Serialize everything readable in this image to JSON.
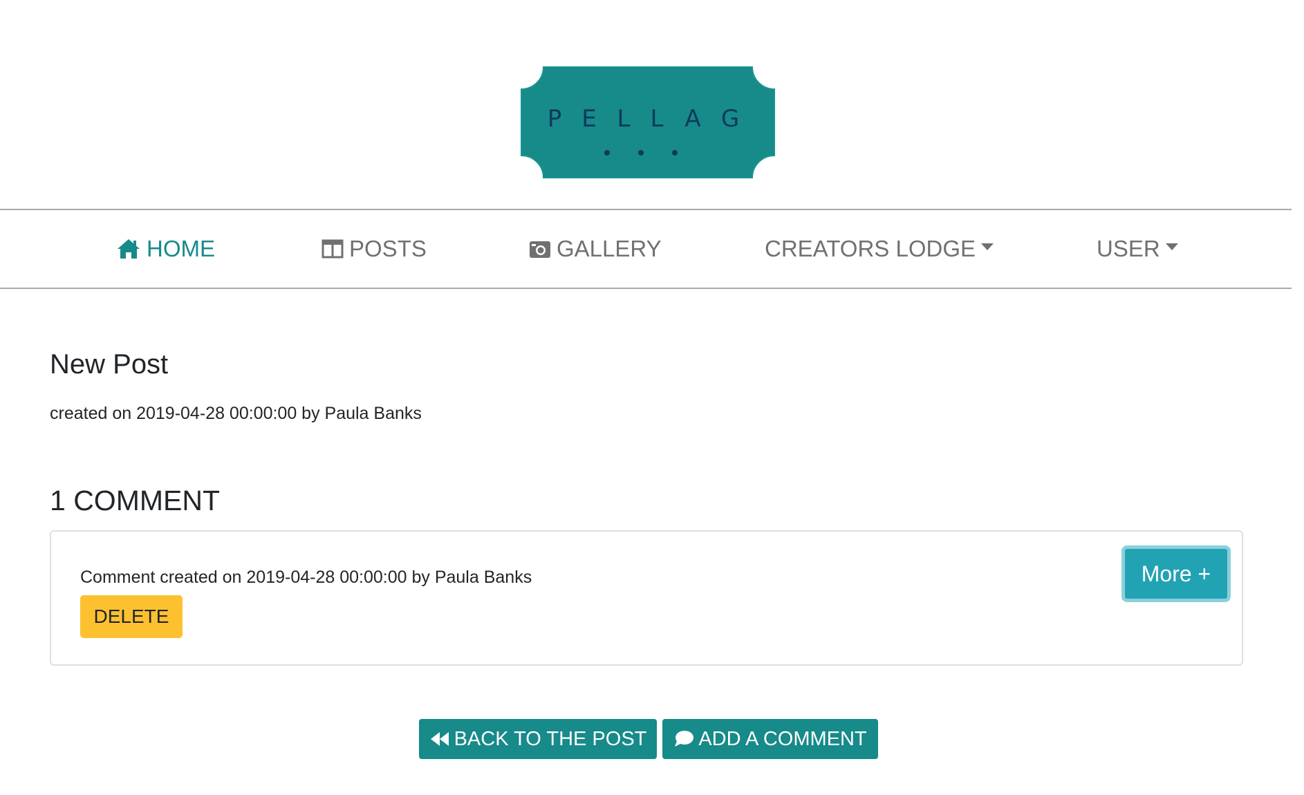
{
  "logo": {
    "text": "PELLAG",
    "colors": {
      "background": "#178a8a",
      "text": "#0f3a5c"
    }
  },
  "nav": {
    "items": [
      {
        "label": "HOME",
        "icon": "home-icon",
        "active": true
      },
      {
        "label": "POSTS",
        "icon": "columns-icon"
      },
      {
        "label": "GALLERY",
        "icon": "camera-icon"
      },
      {
        "label": "CREATORS LODGE",
        "icon": "chevron-down-icon",
        "dropdown": true
      },
      {
        "label": "USER",
        "icon": "chevron-down-icon",
        "dropdown": true
      }
    ]
  },
  "post": {
    "title": "New Post",
    "meta": "created on 2019-04-28 00:00:00 by Paula Banks"
  },
  "comments": {
    "heading": "1 COMMENT",
    "items": [
      {
        "meta": "Comment created on 2019-04-28 00:00:00 by Paula Banks",
        "delete_label": "DELETE",
        "more_label": "More +"
      }
    ]
  },
  "actions": {
    "back_label": "BACK TO THE POST",
    "add_label": "ADD A COMMENT"
  },
  "colors": {
    "primary": "#178a8a",
    "nav_text": "#707070",
    "warning": "#fdc130",
    "info": "#22a3b4"
  }
}
